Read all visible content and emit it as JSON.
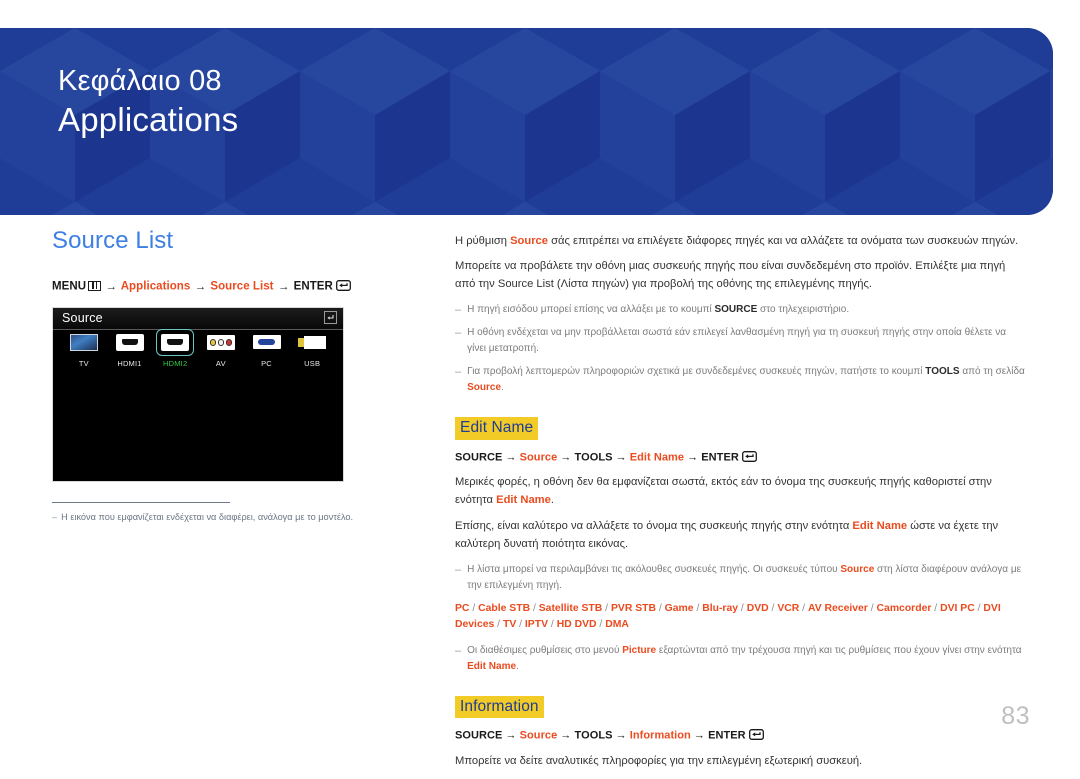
{
  "header": {
    "chapter_label": "Κεφάλαιο 08",
    "chapter_title": "Applications",
    "bg_color": "#1f3c97"
  },
  "left": {
    "section_title": "Source List",
    "menu_path": {
      "menu": "MENU",
      "menu_icon": "menu-grid-icon",
      "arrow": "→",
      "step1": "Applications",
      "step2": "Source List",
      "enter": "ENTER",
      "enter_icon": "enter-key-icon"
    },
    "osd": {
      "title": "Source",
      "return_icon": "return-icon",
      "sources": [
        {
          "label": "TV",
          "icon": "tv-icon",
          "selected": false
        },
        {
          "label": "HDMI1",
          "icon": "hdmi-icon",
          "selected": false
        },
        {
          "label": "HDMI2",
          "icon": "hdmi-icon",
          "selected": true
        },
        {
          "label": "AV",
          "icon": "av-rca-icon",
          "selected": false
        },
        {
          "label": "PC",
          "icon": "vga-icon",
          "selected": false
        },
        {
          "label": "USB",
          "icon": "usb-icon",
          "selected": false
        }
      ]
    },
    "footnote": {
      "dash": "‒",
      "text": "Η εικόνα που εμφανίζεται ενδέχεται να διαφέρει, ανάλογα με το μοντέλο."
    }
  },
  "right": {
    "intro": {
      "p1_before": "Η ρύθμιση ",
      "p1_hl": "Source",
      "p1_after": " σάς επιτρέπει να επιλέγετε διάφορες πηγές και να αλλάζετε τα ονόματα των συσκευών πηγών.",
      "p2": "Μπορείτε να προβάλετε την οθόνη μιας συσκευής πηγής που είναι συνδεδεμένη στο προϊόν. Επιλέξτε μια πηγή από την Source List (Λίστα πηγών) για προβολή της οθόνης της επιλεγμένης πηγής."
    },
    "notes_intro": [
      {
        "dash": "‒",
        "before": "Η πηγή εισόδου μπορεί επίσης να αλλάξει με το κουμπί ",
        "bold": "SOURCE",
        "after": " στο τηλεχειριστήριο."
      },
      {
        "dash": "‒",
        "before": "Η οθόνη ενδέχεται να μην προβάλλεται σωστά εάν επιλεγεί λανθασμένη πηγή για τη συσκευή πηγής στην οποία θέλετε να γίνει μετατροπή.",
        "bold": "",
        "after": ""
      },
      {
        "dash": "‒",
        "before": "Για προβολή λεπτομερών πληροφοριών σχετικά με συνδεδεμένες συσκευές πηγών, πατήστε το κουμπί ",
        "bold": "TOOLS",
        "mid": " από τη σελίδα ",
        "red": "Source",
        "after": "."
      }
    ],
    "edit_name": {
      "heading": "Edit Name",
      "path": {
        "source": "SOURCE",
        "arrow": "→",
        "hl1": "Source",
        "tools": "TOOLS",
        "hl2": "Edit Name",
        "enter": "ENTER",
        "enter_icon": "enter-key-icon"
      },
      "p1_before": "Μερικές φορές, η οθόνη δεν θα εμφανίζεται σωστά, εκτός εάν το όνομα της συσκευής πηγής καθοριστεί στην ενότητα ",
      "p1_hl": "Edit Name",
      "p1_after": ".",
      "p2_before": "Επίσης, είναι καλύτερο να αλλάξετε το όνομα της συσκευής πηγής στην ενότητα ",
      "p2_hl": "Edit Name",
      "p2_after": " ώστε να έχετε την καλύτερη δυνατή ποιότητα εικόνας.",
      "note_list": {
        "dash": "‒",
        "before": "Η λίστα μπορεί να περιλαμβάνει τις ακόλουθες συσκευές πηγής. Οι συσκευές τύπου ",
        "red": "Source",
        "after": " στη λίστα διαφέρουν ανάλογα με την επιλεγμένη πηγή."
      },
      "devices": [
        "PC",
        "Cable STB",
        "Satellite STB",
        "PVR STB",
        "Game",
        "Blu-ray",
        "DVD",
        "VCR",
        "AV Receiver",
        "Camcorder",
        "DVI PC",
        "DVI Devices",
        "TV",
        "IPTV",
        "HD DVD",
        "DMA"
      ],
      "device_separator": "/",
      "note_picture": {
        "dash": "‒",
        "before": "Οι διαθέσιμες ρυθμίσεις στο μενού ",
        "red1": "Picture",
        "mid": " εξαρτώνται από την τρέχουσα πηγή και τις ρυθμίσεις που έχουν γίνει στην ενότητα ",
        "red2": "Edit Name",
        "after": "."
      }
    },
    "information": {
      "heading": "Information",
      "path": {
        "source": "SOURCE",
        "arrow": "→",
        "hl1": "Source",
        "tools": "TOOLS",
        "hl2": "Information",
        "enter": "ENTER",
        "enter_icon": "enter-key-icon"
      },
      "p1": "Μπορείτε να δείτε αναλυτικές πληροφορίες για την επιλεγμένη εξωτερική συσκευή."
    }
  },
  "page_number": "83",
  "colors": {
    "banner": "#1f3c97",
    "section_title": "#3d7fe3",
    "accent_red": "#ea4b1f",
    "highlight_yellow": "#f2cb27",
    "heading_blue": "#1f3c97"
  }
}
